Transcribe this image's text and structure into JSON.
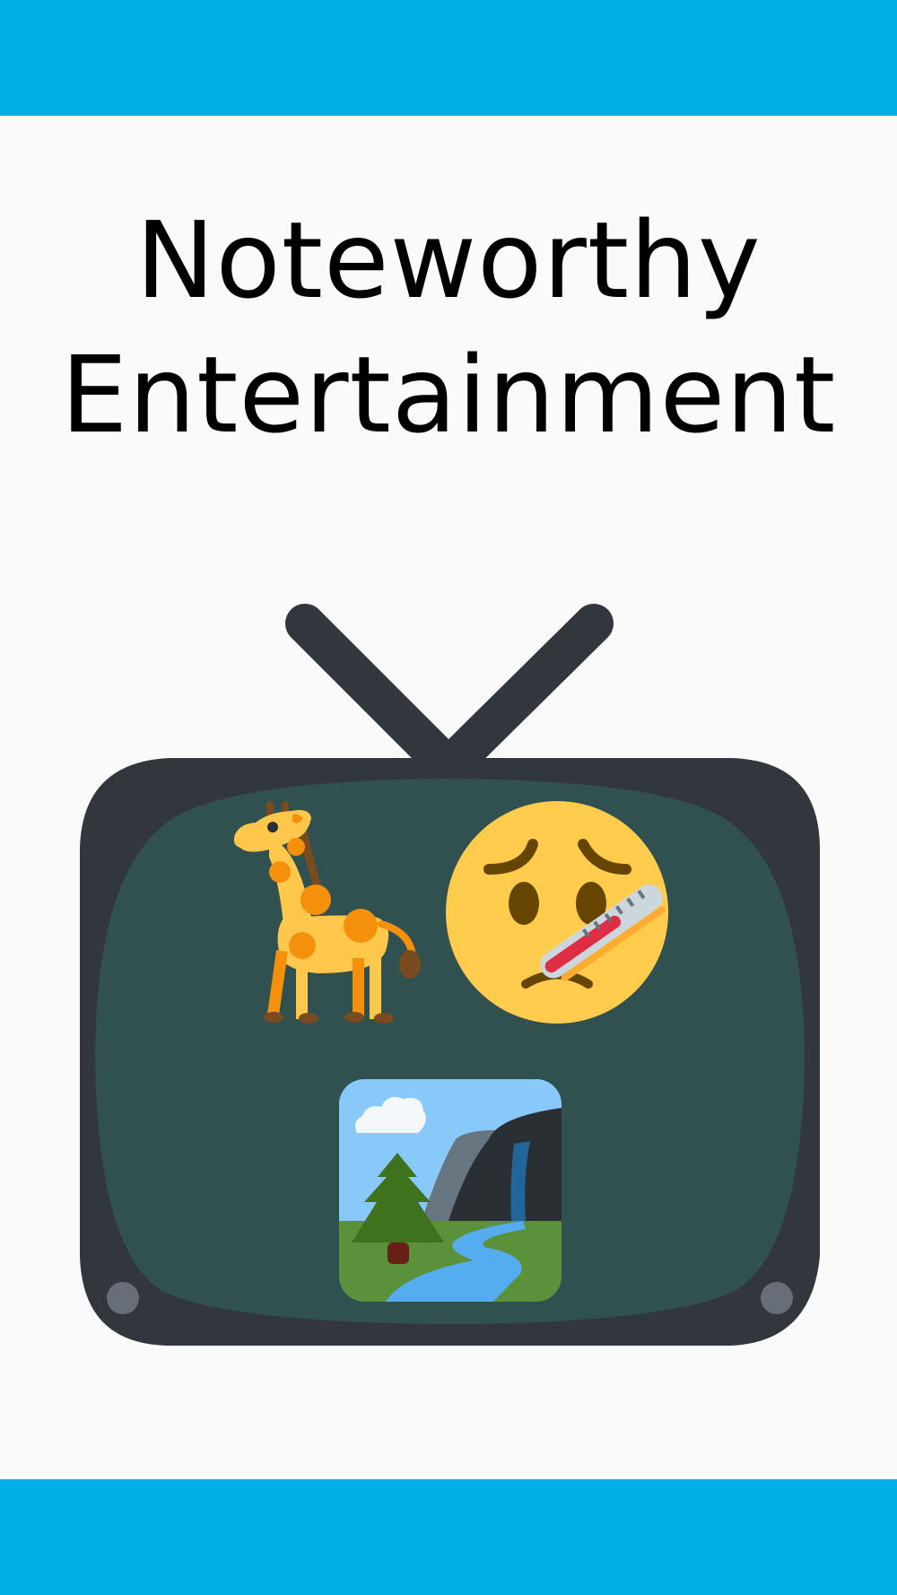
{
  "title": {
    "line1": "Noteworthy",
    "line2": "Entertainment"
  },
  "colors": {
    "banner": "#00aee8",
    "background": "#fafafa",
    "tv_frame": "#32363d",
    "tv_screen": "#30514f",
    "knob": "#676e77"
  },
  "tv": {
    "icon": "television-icon",
    "screen_icons": [
      "giraffe-icon",
      "face-with-thermometer-icon",
      "national-park-icon"
    ]
  }
}
